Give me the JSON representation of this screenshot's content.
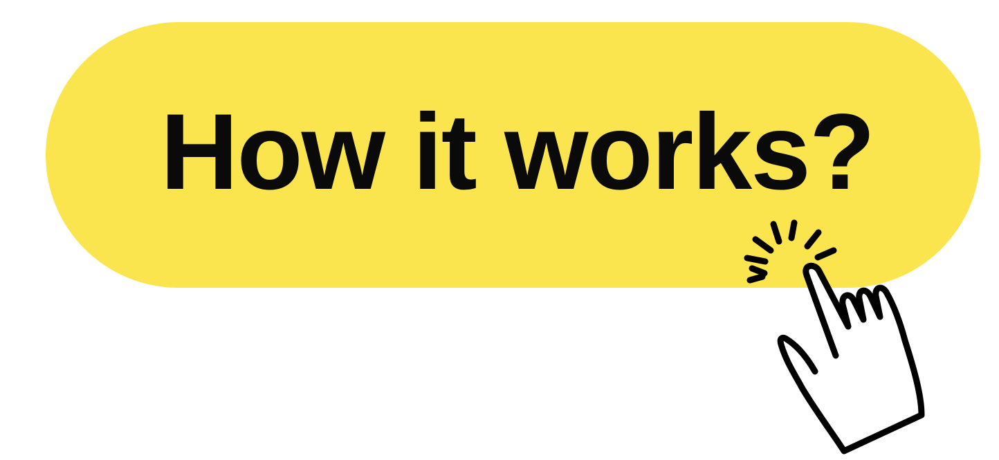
{
  "button": {
    "label": "How it works?"
  },
  "icons": {
    "pointer": "hand-pointer-click-icon"
  },
  "colors": {
    "button_background": "#fbe54e",
    "text": "#0a0a0a",
    "page_background": "#ffffff"
  }
}
